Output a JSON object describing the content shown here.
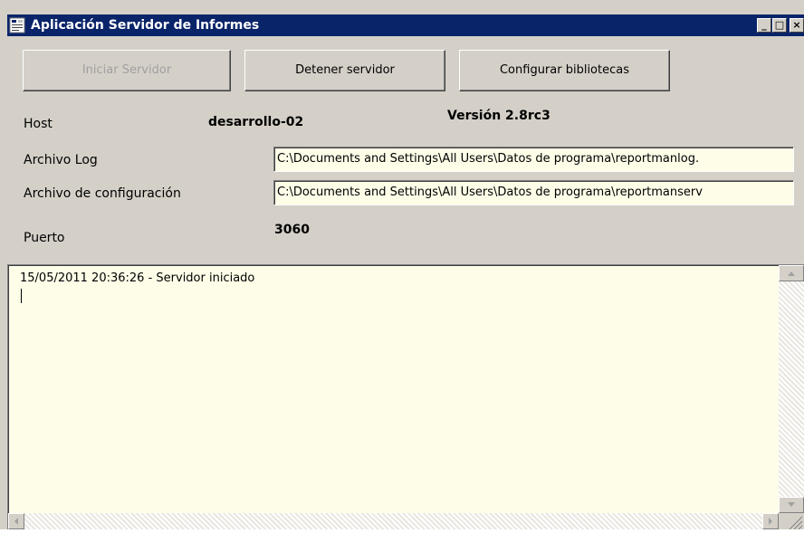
{
  "window": {
    "title": "Aplicación Servidor de Informes",
    "minimize_glyph": "_",
    "maximize_glyph": "□",
    "close_glyph": "×"
  },
  "toolbar": {
    "start_label": "Iniciar Servidor",
    "start_enabled": false,
    "stop_label": "Detener servidor",
    "config_label": "Configurar bibliotecas"
  },
  "info": {
    "host_label": "Host",
    "host_value": "desarrollo-02",
    "version_value": "Versión 2.8rc3",
    "log_label": "Archivo Log",
    "log_value": "C:\\Documents and Settings\\All Users\\Datos de programa\\reportmanlog.",
    "config_label": "Archivo de configuración",
    "config_value": "C:\\Documents and Settings\\All Users\\Datos de programa\\reportmanserv",
    "port_label": "Puerto",
    "port_value": "3060"
  },
  "log": {
    "lines": "15/05/2011 20:36:26 - Servidor iniciado"
  },
  "colors": {
    "titlebar": "#0a246a",
    "face": "#d4d0c8",
    "field_bg": "#fefde8"
  }
}
